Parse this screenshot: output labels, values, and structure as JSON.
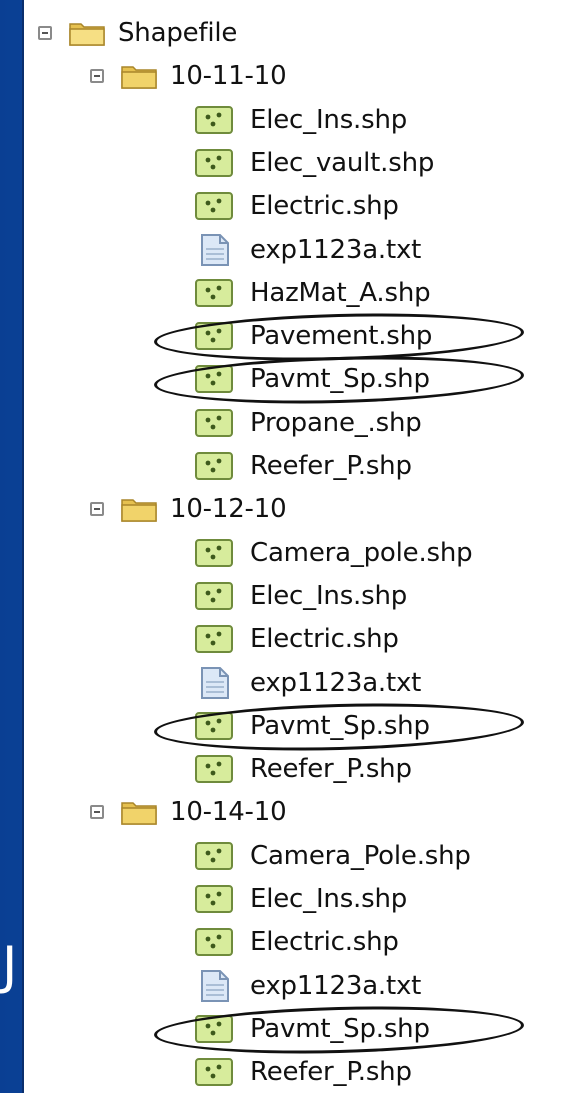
{
  "edge_glyph": "J",
  "tree": {
    "root": {
      "label": "Shapefile"
    },
    "folders": [
      {
        "label": "10-11-10",
        "items": [
          {
            "label": "Elec_Ins.shp",
            "type": "shp"
          },
          {
            "label": "Elec_vault.shp",
            "type": "shp"
          },
          {
            "label": "Electric.shp",
            "type": "shp"
          },
          {
            "label": "exp1123a.txt",
            "type": "txt"
          },
          {
            "label": "HazMat_A.shp",
            "type": "shp"
          },
          {
            "label": "Pavement.shp",
            "type": "shp",
            "circled": true
          },
          {
            "label": "Pavmt_Sp.shp",
            "type": "shp",
            "circled": true
          },
          {
            "label": "Propane_.shp",
            "type": "shp"
          },
          {
            "label": "Reefer_P.shp",
            "type": "shp"
          }
        ]
      },
      {
        "label": "10-12-10",
        "items": [
          {
            "label": "Camera_pole.shp",
            "type": "shp"
          },
          {
            "label": "Elec_Ins.shp",
            "type": "shp"
          },
          {
            "label": "Electric.shp",
            "type": "shp"
          },
          {
            "label": "exp1123a.txt",
            "type": "txt"
          },
          {
            "label": "Pavmt_Sp.shp",
            "type": "shp",
            "circled": true
          },
          {
            "label": "Reefer_P.shp",
            "type": "shp"
          }
        ]
      },
      {
        "label": "10-14-10",
        "items": [
          {
            "label": "Camera_Pole.shp",
            "type": "shp"
          },
          {
            "label": "Elec_Ins.shp",
            "type": "shp"
          },
          {
            "label": "Electric.shp",
            "type": "shp"
          },
          {
            "label": "exp1123a.txt",
            "type": "txt"
          },
          {
            "label": "Pavmt_Sp.shp",
            "type": "shp",
            "circled": true
          },
          {
            "label": "Reefer_P.shp",
            "type": "shp"
          }
        ]
      }
    ]
  },
  "colors": {
    "background_blue": "#0d4fae",
    "folder_yellow": "#f1d36a",
    "shp_green": "#d7ec9c",
    "txt_blue": "#dce8f7",
    "circle": "#111111"
  }
}
